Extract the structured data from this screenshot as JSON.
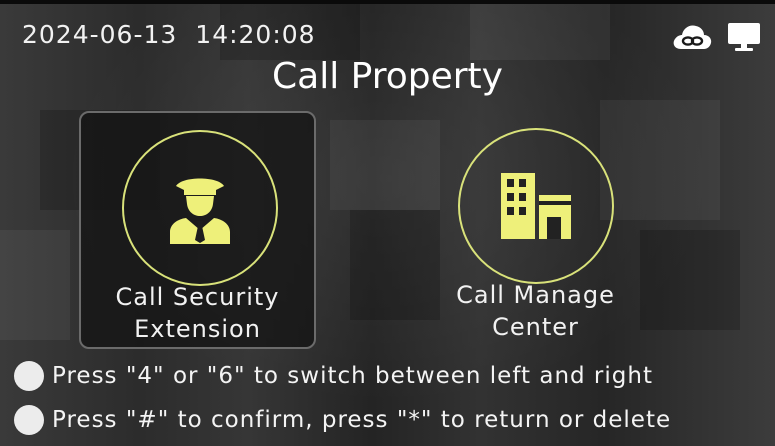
{
  "status_bar": {
    "date": "2024-06-13",
    "time": "14:20:08",
    "icons": [
      "cloud-link-icon",
      "monitor-icon"
    ]
  },
  "title": "Call Property",
  "options": [
    {
      "icon": "security-guard-icon",
      "line1": "Call Security",
      "line2": "Extension",
      "selected": true
    },
    {
      "icon": "building-icon",
      "line1": "Call Manage",
      "line2": "Center",
      "selected": false
    }
  ],
  "hints": [
    "Press \"4\" or \"6\" to switch between left and right",
    "Press \"#\" to confirm, press \"*\" to return or delete"
  ],
  "colors": {
    "accent": "#d9e27a",
    "icon_fill": "#eef07a",
    "selected_panel": "#141414"
  }
}
